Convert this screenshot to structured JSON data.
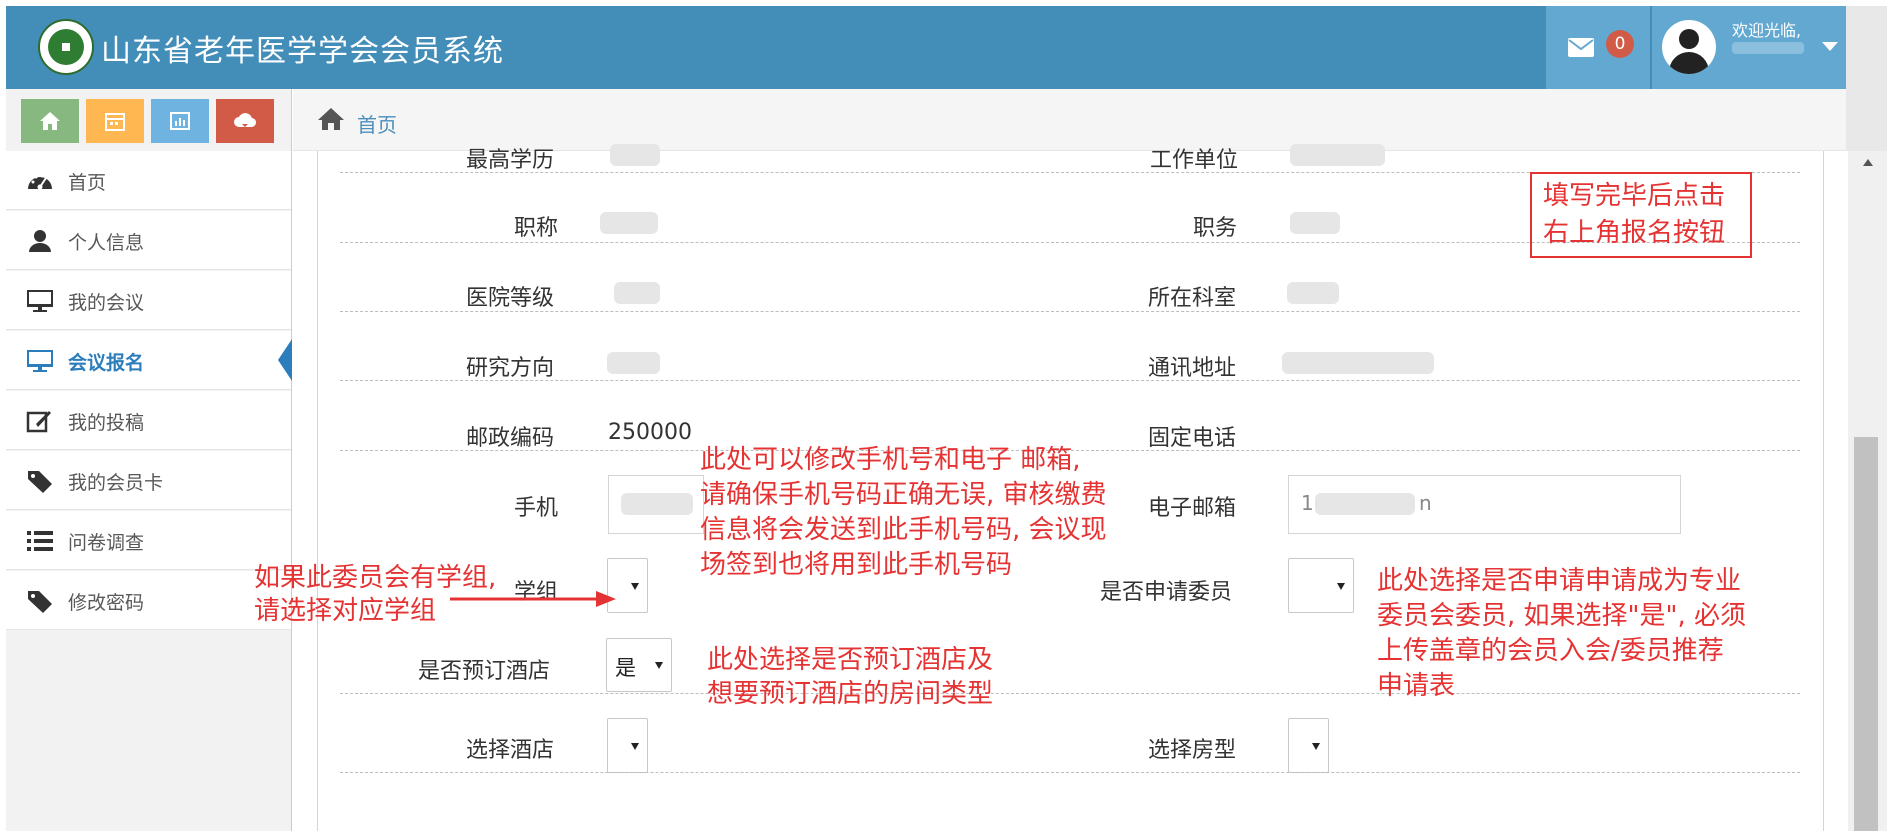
{
  "header": {
    "title": "山东省老年医学学会会员系统",
    "message_count": "0",
    "welcome": "欢迎光临,",
    "colors": {
      "bar": "#438eb9",
      "accent": "#62a8d1",
      "badge": "#d15b47"
    }
  },
  "shortcuts": [
    {
      "icon": "home-icon",
      "color": "#87b87f"
    },
    {
      "icon": "calendar-icon",
      "color": "#ffb752"
    },
    {
      "icon": "chart-icon",
      "color": "#6fb3e0"
    },
    {
      "icon": "cloud-download-icon",
      "color": "#d15b47"
    }
  ],
  "breadcrumb": {
    "home": "首页"
  },
  "sidebar": {
    "items": [
      {
        "label": "首页",
        "icon": "dashboard-icon"
      },
      {
        "label": "个人信息",
        "icon": "user-icon"
      },
      {
        "label": "我的会议",
        "icon": "desktop-icon"
      },
      {
        "label": "会议报名",
        "icon": "desktop-icon",
        "active": true
      },
      {
        "label": "我的投稿",
        "icon": "edit-icon"
      },
      {
        "label": "我的会员卡",
        "icon": "tag-icon"
      },
      {
        "label": "问卷调查",
        "icon": "list-icon"
      },
      {
        "label": "修改密码",
        "icon": "tag-icon"
      }
    ]
  },
  "form": {
    "row0": {
      "left_label": "最高学历",
      "right_label": "工作单位"
    },
    "row1": {
      "left_label": "职称",
      "right_label": "职务"
    },
    "row2": {
      "left_label": "医院等级",
      "right_label": "所在科室"
    },
    "row3": {
      "left_label": "研究方向",
      "right_label": "通讯地址"
    },
    "row4": {
      "left_label": "邮政编码",
      "left_value": "250000",
      "right_label": "固定电话"
    },
    "row5": {
      "left_label": "手机",
      "right_label": "电子邮箱",
      "email_value": "1",
      "email_suffix": "n"
    },
    "row6": {
      "left_label": "学组",
      "right_label": "是否申请委员"
    },
    "row7": {
      "left_label": "是否预订酒店",
      "hotel_value": "是"
    },
    "row8": {
      "left_label": "选择酒店",
      "right_label": "选择房型"
    }
  },
  "annotations": {
    "submit_hint": [
      "填写完毕后点击",
      "右上角报名按钮"
    ],
    "phone_hint": [
      "此处可以修改手机号和电子  邮箱,",
      "请确保手机号码正确无误, 审核缴费",
      "信息将会发送到此手机号码, 会议现",
      "场签到也将用到此手机号码"
    ],
    "group_hint": [
      "如果此委员会有学组,",
      "请选择对应学组"
    ],
    "committee_hint": [
      "此处选择是否申请申请成为专业",
      "委员会委员, 如果选择\"是\", 必须",
      "上传盖章的会员入会/委员推荐",
      "申请表"
    ],
    "hotel_hint": [
      "此处选择是否预订酒店及",
      "想要预订酒店的房间类型"
    ],
    "color": "#e53333"
  }
}
